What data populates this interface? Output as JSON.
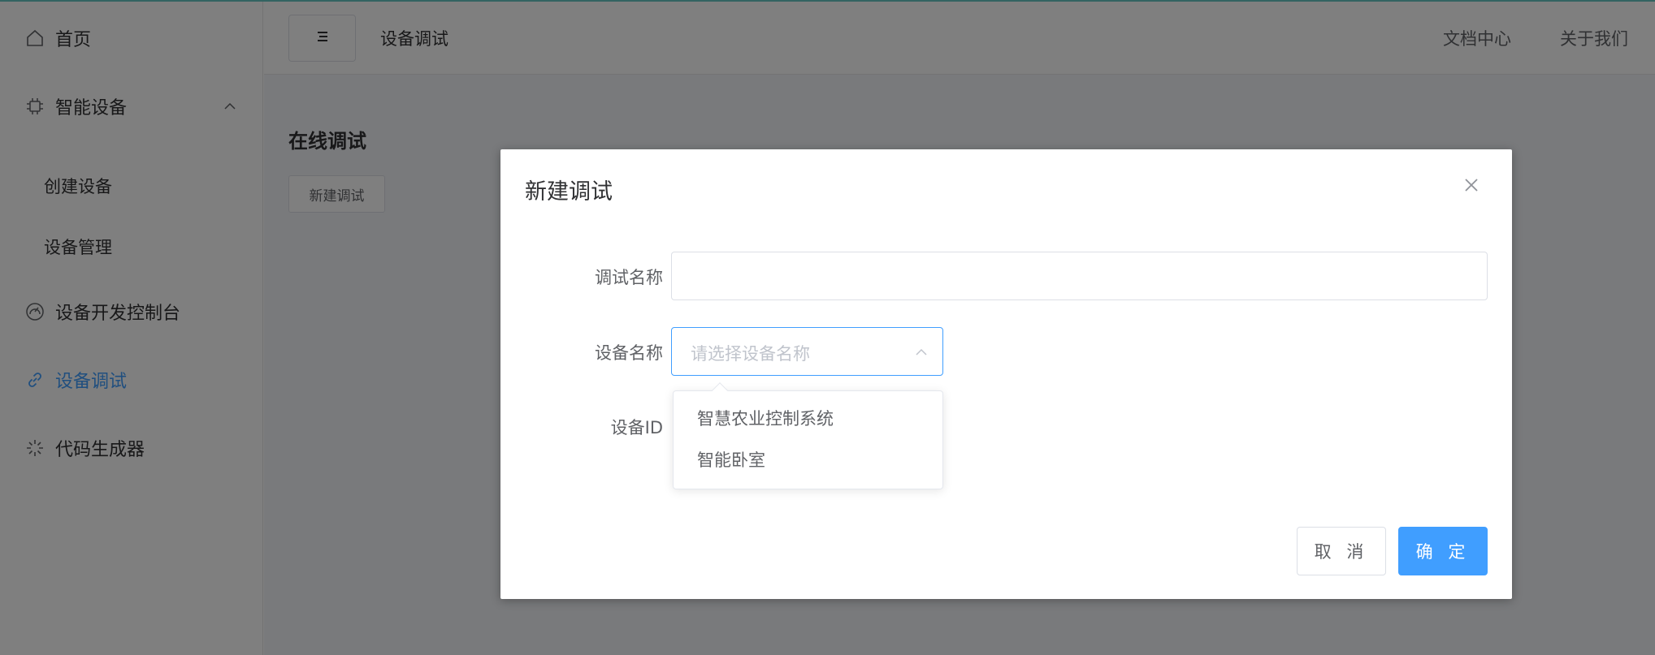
{
  "sidebar": {
    "items": [
      {
        "label": "首页",
        "icon": "home-icon"
      },
      {
        "label": "智能设备",
        "icon": "chip-icon",
        "expanded": true,
        "children": [
          {
            "label": "创建设备"
          },
          {
            "label": "设备管理"
          }
        ]
      },
      {
        "label": "设备开发控制台",
        "icon": "dashboard-icon"
      },
      {
        "label": "设备调试",
        "icon": "link-icon",
        "active": true
      },
      {
        "label": "代码生成器",
        "icon": "loading-icon"
      }
    ]
  },
  "header": {
    "breadcrumb": "设备调试",
    "links": [
      "文档中心",
      "关于我们"
    ]
  },
  "main": {
    "title": "在线调试",
    "new_button": "新建调试"
  },
  "dialog": {
    "title": "新建调试",
    "fields": {
      "name_label": "调试名称",
      "name_value": "",
      "device_label": "设备名称",
      "device_placeholder": "请选择设备名称",
      "id_label": "设备ID"
    },
    "options": [
      "智慧农业控制系统",
      "智能卧室"
    ],
    "cancel": "取 消",
    "ok": "确 定"
  },
  "colors": {
    "accent": "#409eff",
    "overlay": "rgba(0,0,0,0.5)",
    "page_bg": "#f2f4f8"
  }
}
